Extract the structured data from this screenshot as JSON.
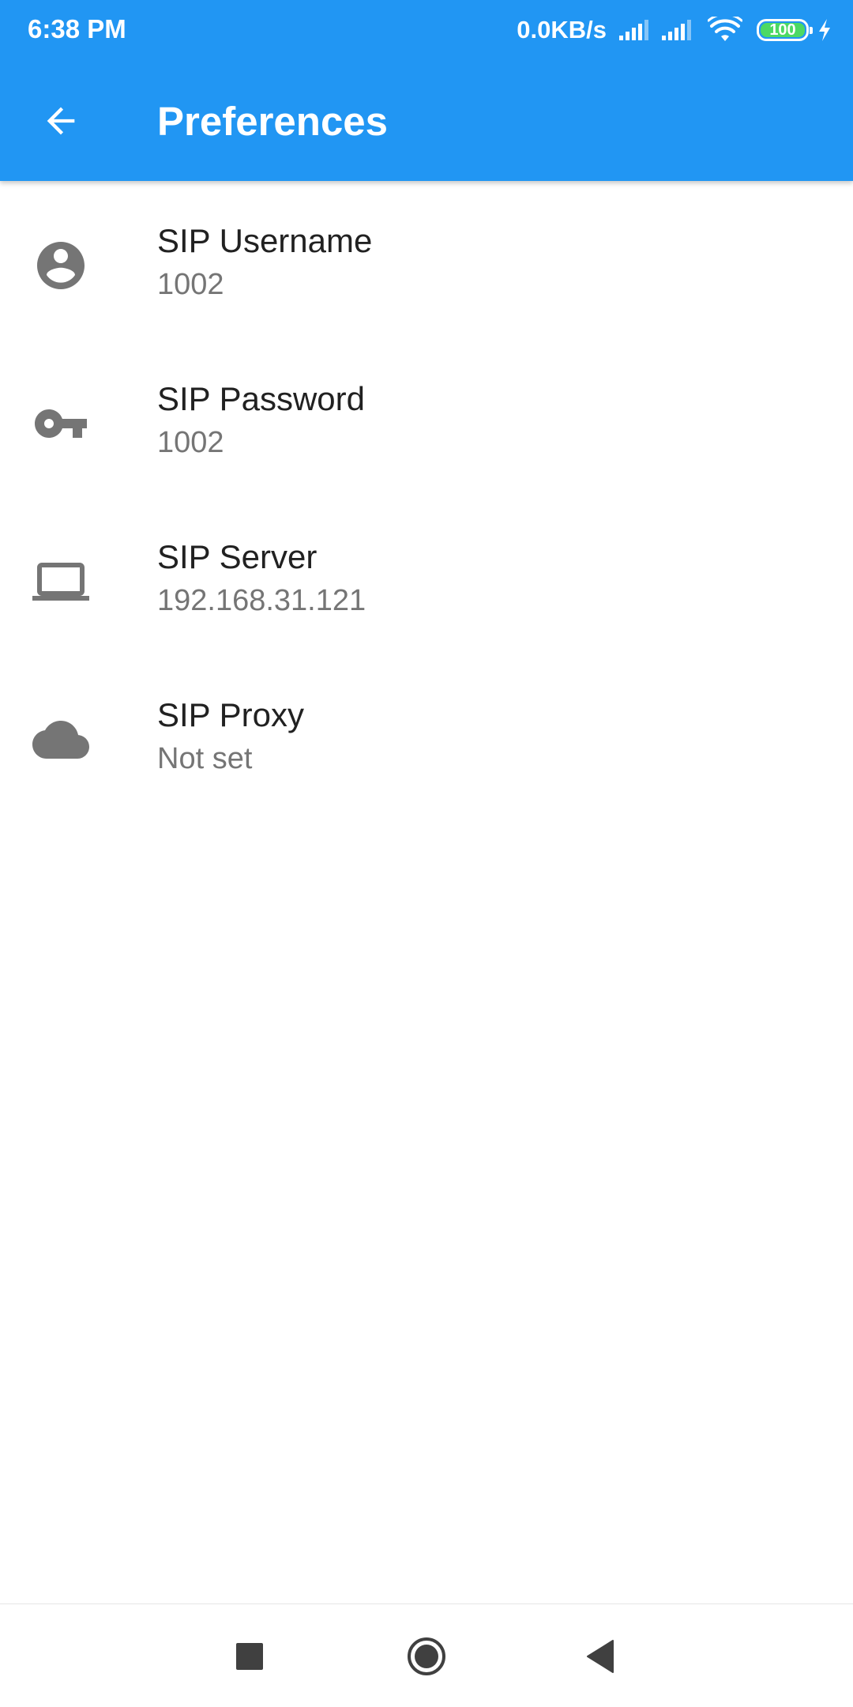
{
  "status_bar": {
    "time": "6:38 PM",
    "net_speed": "0.0KB/s",
    "battery_level": "100",
    "battery_color": "#4CD964"
  },
  "app_bar": {
    "title": "Preferences",
    "back_icon": "arrow-left-icon",
    "color": "#2196F3"
  },
  "preferences": [
    {
      "icon": "account-circle-icon",
      "title": "SIP Username",
      "summary": "1002"
    },
    {
      "icon": "key-icon",
      "title": "SIP Password",
      "summary": "1002"
    },
    {
      "icon": "laptop-icon",
      "title": "SIP Server",
      "summary": "192.168.31.121"
    },
    {
      "icon": "cloud-icon",
      "title": "SIP Proxy",
      "summary": "Not set"
    }
  ],
  "nav_bar": {
    "recents_icon": "square-recents-icon",
    "home_icon": "circle-home-icon",
    "back_icon": "triangle-back-icon"
  }
}
